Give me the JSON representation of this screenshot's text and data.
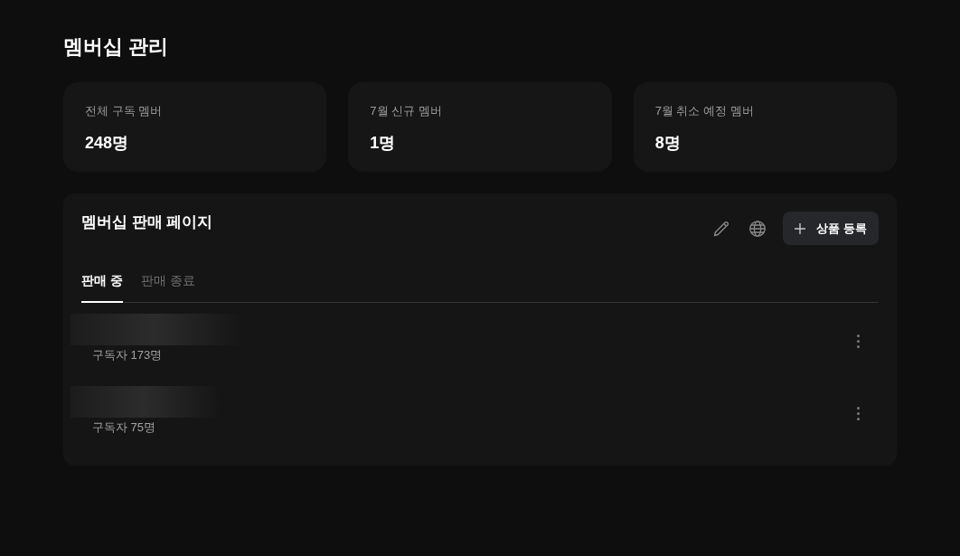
{
  "page": {
    "title": "멤버십 관리"
  },
  "stats": [
    {
      "label": "전체 구독 멤버",
      "value": "248명"
    },
    {
      "label": "7월 신규 멤버",
      "value": "1명"
    },
    {
      "label": "7월 취소 예정 멤버",
      "value": "8명"
    }
  ],
  "sales_panel": {
    "title": "멤버십 판매 페이지",
    "add_button": "상품 등록",
    "tabs": [
      {
        "label": "판매 중",
        "selected": true
      },
      {
        "label": "판매 종료",
        "selected": false
      }
    ],
    "products": [
      {
        "subscribers": "구독자 173명"
      },
      {
        "subscribers": "구독자 75명"
      }
    ]
  }
}
